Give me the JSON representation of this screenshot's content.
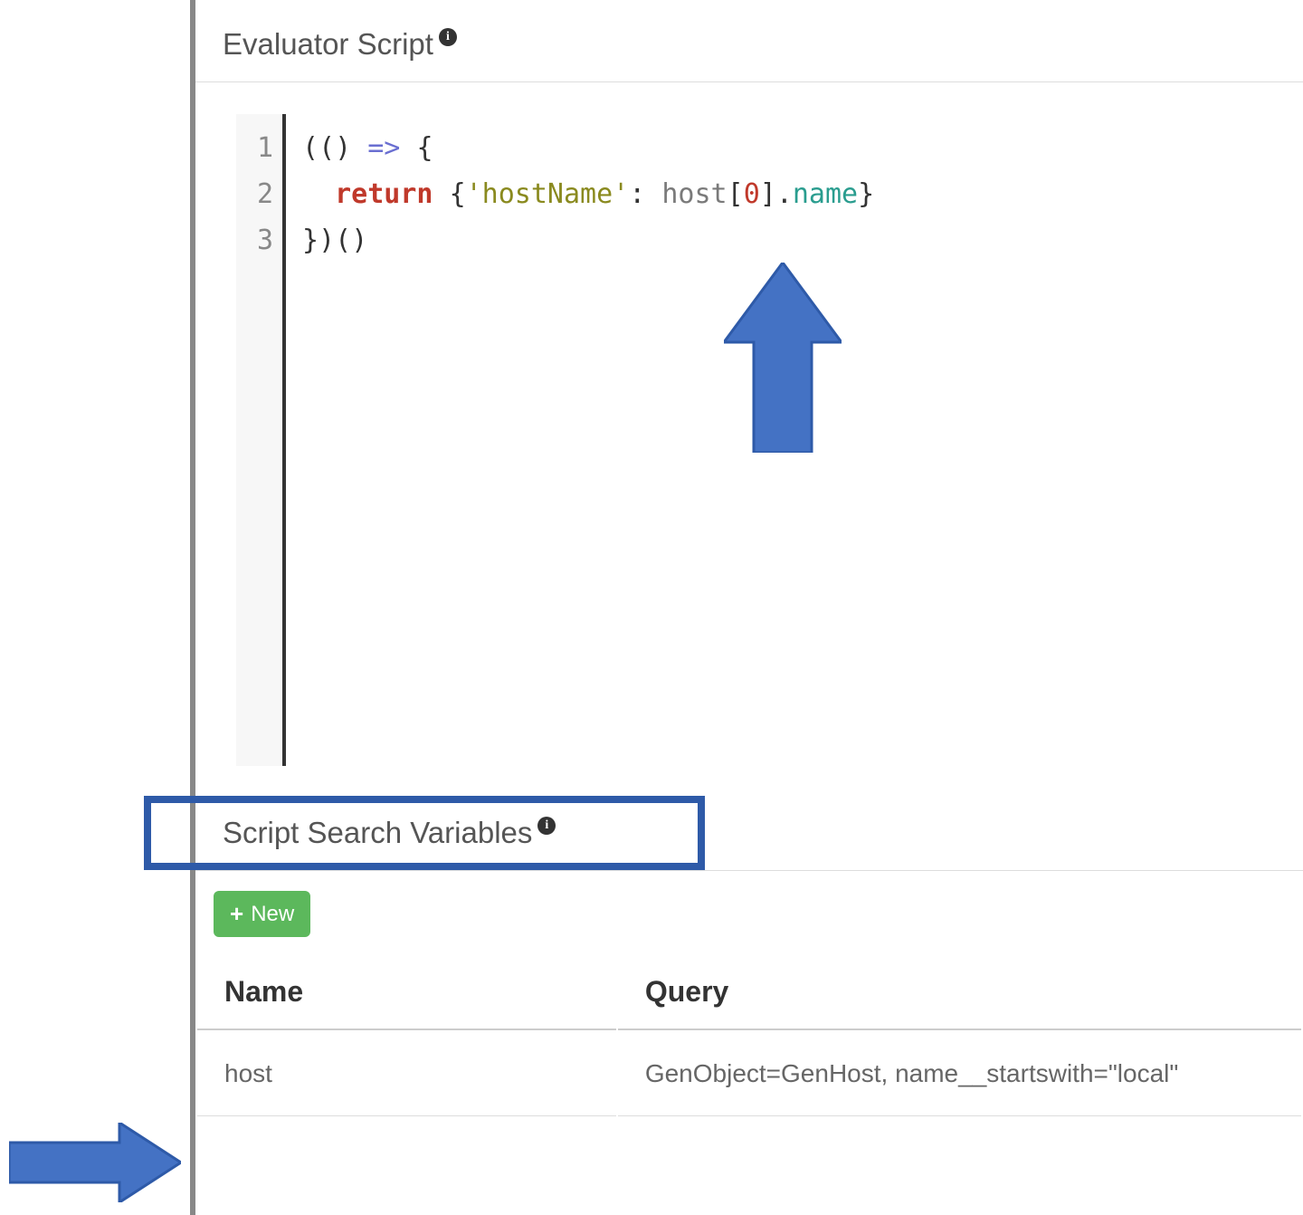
{
  "header": {
    "evaluator_title": "Evaluator Script"
  },
  "code": {
    "lines": [
      "1",
      "2",
      "3"
    ],
    "t_open_paren1": "(",
    "t_open_paren2": "(",
    "t_close_paren1": ")",
    "t_sp": " ",
    "t_arrow": "=>",
    "t_lbrace": "{",
    "t_indent": "  ",
    "t_return": "return",
    "t_lbrace2": "{",
    "t_string": "'hostName'",
    "t_colon": ":",
    "t_host": "host",
    "t_lbracket": "[",
    "t_zero": "0",
    "t_rbracket": "]",
    "t_dot": ".",
    "t_name": "name",
    "t_rbrace2": "}",
    "t_rbrace": "}",
    "t_close_paren2": ")",
    "t_open_paren3": "(",
    "t_close_paren3": ")"
  },
  "vars": {
    "title": "Script Search Variables",
    "new_label": "New",
    "columns": {
      "name": "Name",
      "query": "Query"
    },
    "rows": [
      {
        "name": "host",
        "query": "GenObject=GenHost, name__startswith=\"local\""
      }
    ]
  }
}
